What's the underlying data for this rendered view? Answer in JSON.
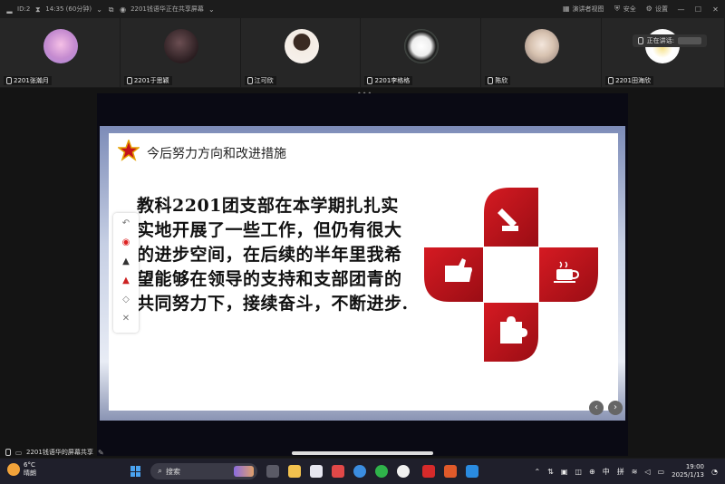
{
  "topbar": {
    "meeting_id": "ID:2",
    "time_info": "14:35 (60分钟)",
    "share_info": "2201钱语华正在共享屏幕",
    "view_label": "演讲者视图",
    "security_label": "安全",
    "settings_label": "设置"
  },
  "participants": [
    {
      "name": "2201张瀚月",
      "avatar_color": "#d48fc4"
    },
    {
      "name": "2201于思颖",
      "avatar_color": "#3a2b2d"
    },
    {
      "name": "江可欣",
      "avatar_color": "#f0e8e0"
    },
    {
      "name": "2201李格格",
      "avatar_color": "#e8e8e8"
    },
    {
      "name": "陈欣",
      "avatar_color": "#c9b7a8"
    },
    {
      "name": "2201田海欣",
      "avatar_color": "#f2f2f2"
    }
  ],
  "speaking_label": "正在讲话:",
  "slide": {
    "title": "今后努力方向和改进措施",
    "body": "教科2201团支部在本学期扎扎实实地开展了一些工作，但仍有很大的进步空间，在后续的半年里我希望能够在领导的支持和支部团青的共同努力下，接续奋斗，不断进步.",
    "accent_color": "#b0121b"
  },
  "share_bar": {
    "label": "2201钱语华的屏幕共享"
  },
  "taskbar": {
    "temperature": "6°C",
    "weather": "晴朗",
    "search_placeholder": "搜索",
    "ime1": "中",
    "ime2": "拼",
    "time": "19:00",
    "date": "2025/1/13"
  }
}
